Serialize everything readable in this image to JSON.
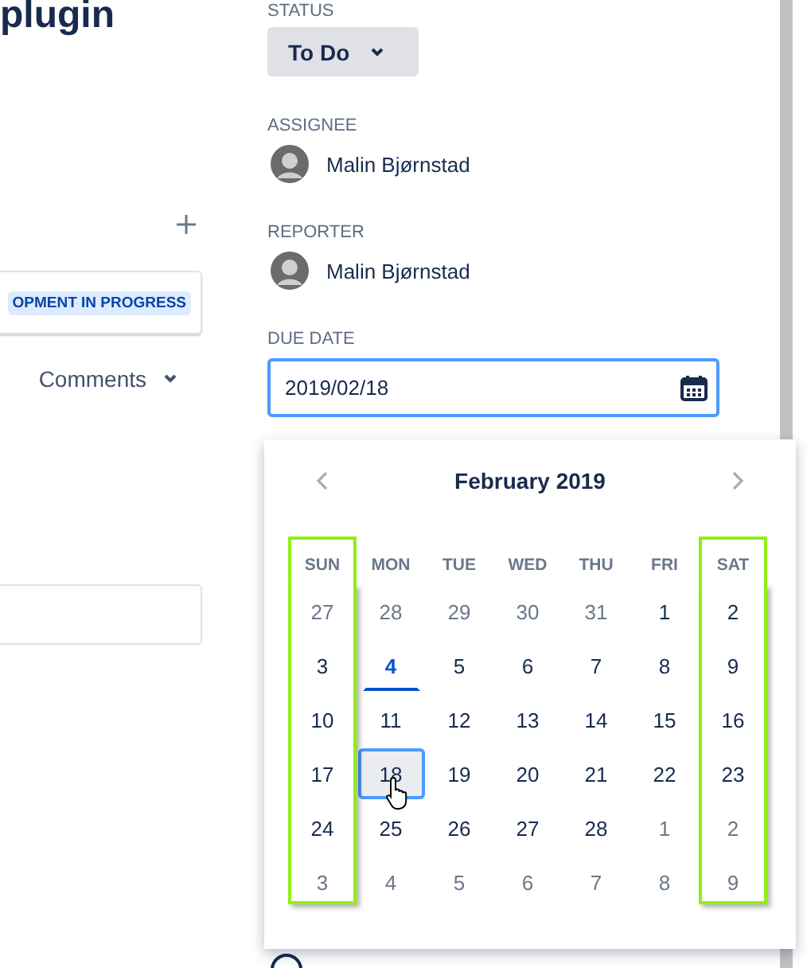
{
  "issue": {
    "title": "plugin",
    "badge": "OPMENT IN PROGRESS",
    "comments_menu": "Comments"
  },
  "fields": [
    {
      "label": "STATUS",
      "kind": "status",
      "value": "To Do"
    },
    {
      "label": "ASSIGNEE",
      "kind": "user",
      "value": "Malin Bjørnstad"
    },
    {
      "label": "REPORTER",
      "kind": "user",
      "value": "Malin Bjørnstad"
    },
    {
      "label": "DUE DATE",
      "kind": "date",
      "value": "2019/02/18"
    }
  ],
  "calendar": {
    "month": "February 2019",
    "weekdays": [
      {
        "label": "SUN",
        "highlighted": true
      },
      {
        "label": "MON",
        "highlighted": false
      },
      {
        "label": "TUE",
        "highlighted": false
      },
      {
        "label": "WED",
        "highlighted": false
      },
      {
        "label": "THU",
        "highlighted": false
      },
      {
        "label": "FRI",
        "highlighted": false
      },
      {
        "label": "SAT",
        "highlighted": true
      }
    ],
    "days": [
      {
        "day": "27",
        "kind": "outside",
        "selected": false
      },
      {
        "day": "28",
        "kind": "outside",
        "selected": false
      },
      {
        "day": "29",
        "kind": "outside",
        "selected": false
      },
      {
        "day": "30",
        "kind": "outside",
        "selected": false
      },
      {
        "day": "31",
        "kind": "outside",
        "selected": false
      },
      {
        "day": "1",
        "kind": "current",
        "selected": false
      },
      {
        "day": "2",
        "kind": "current",
        "selected": false
      },
      {
        "day": "3",
        "kind": "current",
        "selected": false
      },
      {
        "day": "4",
        "kind": "today",
        "selected": false
      },
      {
        "day": "5",
        "kind": "current",
        "selected": false
      },
      {
        "day": "6",
        "kind": "current",
        "selected": false
      },
      {
        "day": "7",
        "kind": "current",
        "selected": false
      },
      {
        "day": "8",
        "kind": "current",
        "selected": false
      },
      {
        "day": "9",
        "kind": "current",
        "selected": false
      },
      {
        "day": "10",
        "kind": "current",
        "selected": false
      },
      {
        "day": "11",
        "kind": "current",
        "selected": false
      },
      {
        "day": "12",
        "kind": "current",
        "selected": false
      },
      {
        "day": "13",
        "kind": "current",
        "selected": false
      },
      {
        "day": "14",
        "kind": "current",
        "selected": false
      },
      {
        "day": "15",
        "kind": "current",
        "selected": false
      },
      {
        "day": "16",
        "kind": "current",
        "selected": false
      },
      {
        "day": "17",
        "kind": "current",
        "selected": false
      },
      {
        "day": "18",
        "kind": "current",
        "selected": true
      },
      {
        "day": "19",
        "kind": "current",
        "selected": false
      },
      {
        "day": "20",
        "kind": "current",
        "selected": false
      },
      {
        "day": "21",
        "kind": "current",
        "selected": false
      },
      {
        "day": "22",
        "kind": "current",
        "selected": false
      },
      {
        "day": "23",
        "kind": "current",
        "selected": false
      },
      {
        "day": "24",
        "kind": "current",
        "selected": false
      },
      {
        "day": "25",
        "kind": "current",
        "selected": false
      },
      {
        "day": "26",
        "kind": "current",
        "selected": false
      },
      {
        "day": "27",
        "kind": "current",
        "selected": false
      },
      {
        "day": "28",
        "kind": "current",
        "selected": false
      },
      {
        "day": "1",
        "kind": "outside",
        "selected": false
      },
      {
        "day": "2",
        "kind": "outside",
        "selected": false
      },
      {
        "day": "3",
        "kind": "outside",
        "selected": false
      },
      {
        "day": "4",
        "kind": "outside",
        "selected": false
      },
      {
        "day": "5",
        "kind": "outside",
        "selected": false
      },
      {
        "day": "6",
        "kind": "outside",
        "selected": false
      },
      {
        "day": "7",
        "kind": "outside",
        "selected": false
      },
      {
        "day": "8",
        "kind": "outside",
        "selected": false
      },
      {
        "day": "9",
        "kind": "outside",
        "selected": false
      }
    ]
  }
}
